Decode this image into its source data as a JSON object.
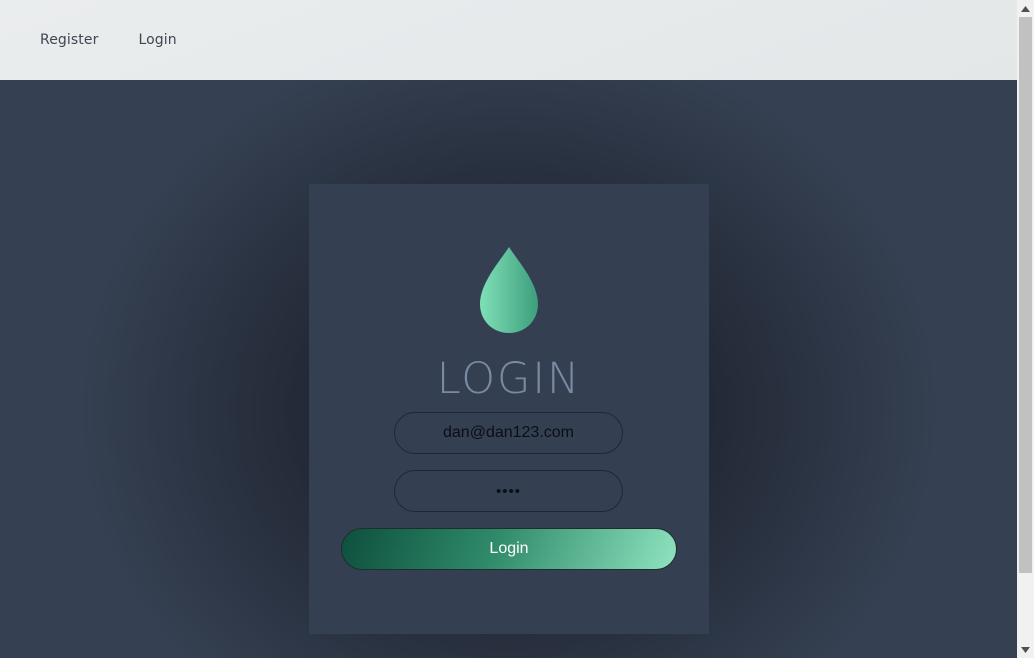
{
  "nav": {
    "links": [
      {
        "label": "Register"
      },
      {
        "label": "Login"
      }
    ]
  },
  "login_card": {
    "logo_icon": "water-drop-icon",
    "title": "LOGIN",
    "email_value": "dan@dan123.com",
    "password_value": "••••",
    "submit_label": "Login"
  },
  "colors": {
    "background": "#354052",
    "navbar": "#e6e9ea",
    "card": "#344052",
    "title": "#7b8aa4",
    "accent_dark": "#0e4f3d",
    "accent_light": "#8fe3bf"
  }
}
